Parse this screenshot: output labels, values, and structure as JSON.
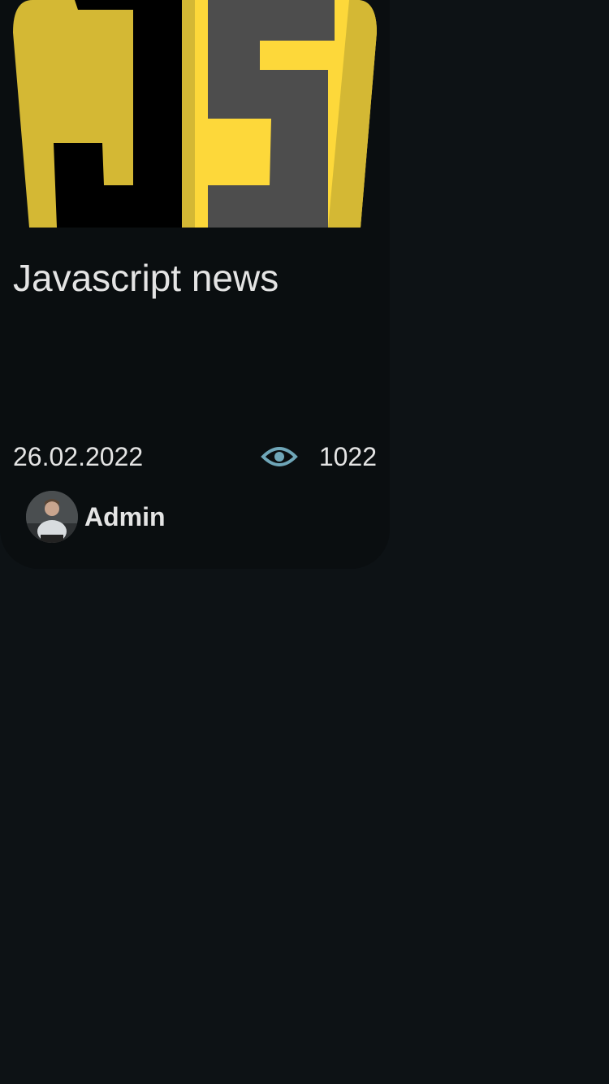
{
  "card": {
    "image": {
      "icon": "javascript-logo",
      "logo_text": "JS",
      "colors": {
        "shield_left": "#d4b834",
        "shield_right": "#fdd83a",
        "j_letter": "#000000",
        "s_letter": "#4d4d4d"
      }
    },
    "title": "Javascript news",
    "date": "26.02.2022",
    "views_icon": "eye-icon",
    "views": "1022",
    "author": {
      "avatar_icon": "avatar-photo",
      "name": "Admin"
    }
  },
  "colors": {
    "page_background": "#0d1215",
    "card_background": "#0a0e10",
    "text": "#e4e4e4",
    "icon_accent": "#6fa6b8"
  }
}
